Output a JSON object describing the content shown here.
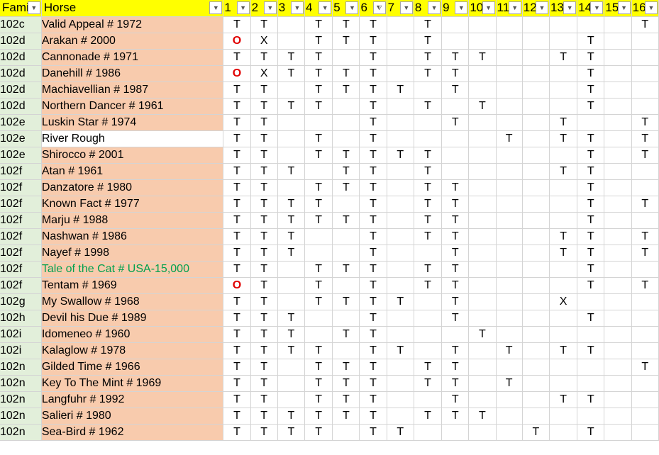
{
  "headers": {
    "family": "Fami",
    "horse": "Horse",
    "nums": [
      "1",
      "2",
      "3",
      "4",
      "5",
      "6",
      "7",
      "8",
      "9",
      "10",
      "11",
      "12",
      "13",
      "14",
      "15",
      "16"
    ],
    "filter_icon_col": "6"
  },
  "rows": [
    {
      "family": "102c",
      "horse": "Valid Appeal #  1972",
      "style": "",
      "cells": [
        "T",
        "T",
        "",
        "T",
        "T",
        "T",
        "",
        "T",
        "",
        "",
        "",
        "",
        "",
        "",
        "",
        "T"
      ]
    },
    {
      "family": "102d",
      "horse": "Arakan #  2000",
      "style": "",
      "cells": [
        "O",
        "X",
        "",
        "T",
        "T",
        "T",
        "",
        "T",
        "",
        "",
        "",
        "",
        "",
        "T",
        "",
        ""
      ]
    },
    {
      "family": "102d",
      "horse": "Cannonade #  1971",
      "style": "",
      "cells": [
        "T",
        "T",
        "T",
        "T",
        "",
        "T",
        "",
        "T",
        "T",
        "T",
        "",
        "",
        "T",
        "T",
        "",
        ""
      ]
    },
    {
      "family": "102d",
      "horse": "Danehill #  1986",
      "style": "",
      "cells": [
        "O",
        "X",
        "T",
        "T",
        "T",
        "T",
        "",
        "T",
        "T",
        "",
        "",
        "",
        "",
        "T",
        "",
        ""
      ]
    },
    {
      "family": "102d",
      "horse": "Machiavellian #  1987",
      "style": "",
      "cells": [
        "T",
        "T",
        "",
        "T",
        "T",
        "T",
        "T",
        "",
        "T",
        "",
        "",
        "",
        "",
        "T",
        "",
        ""
      ]
    },
    {
      "family": "102d",
      "horse": "Northern Dancer #  1961",
      "style": "",
      "cells": [
        "T",
        "T",
        "T",
        "T",
        "",
        "T",
        "",
        "T",
        "",
        "T",
        "",
        "",
        "",
        "T",
        "",
        ""
      ]
    },
    {
      "family": "102e",
      "horse": "Luskin Star #  1974",
      "style": "",
      "cells": [
        "T",
        "T",
        "",
        "",
        "",
        "T",
        "",
        "",
        "T",
        "",
        "",
        "",
        "T",
        "",
        "",
        "T"
      ]
    },
    {
      "family": "102e",
      "horse": "River Rough",
      "style": "white",
      "cells": [
        "T",
        "T",
        "",
        "T",
        "",
        "T",
        "",
        "",
        "",
        "",
        "T",
        "",
        "T",
        "T",
        "",
        "T"
      ]
    },
    {
      "family": "102e",
      "horse": "Shirocco #  2001",
      "style": "",
      "cells": [
        "T",
        "T",
        "",
        "T",
        "T",
        "T",
        "T",
        "T",
        "",
        "",
        "",
        "",
        "",
        "T",
        "",
        "T"
      ]
    },
    {
      "family": "102f",
      "horse": "Atan #  1961",
      "style": "",
      "cells": [
        "T",
        "T",
        "T",
        "",
        "T",
        "T",
        "",
        "T",
        "",
        "",
        "",
        "",
        "T",
        "T",
        "",
        ""
      ]
    },
    {
      "family": "102f",
      "horse": "Danzatore #  1980",
      "style": "",
      "cells": [
        "T",
        "T",
        "",
        "T",
        "T",
        "T",
        "",
        "T",
        "T",
        "",
        "",
        "",
        "",
        "T",
        "",
        ""
      ]
    },
    {
      "family": "102f",
      "horse": "Known Fact #  1977",
      "style": "",
      "cells": [
        "T",
        "T",
        "T",
        "T",
        "",
        "T",
        "",
        "T",
        "T",
        "",
        "",
        "",
        "",
        "T",
        "",
        "T"
      ]
    },
    {
      "family": "102f",
      "horse": "Marju #  1988",
      "style": "",
      "cells": [
        "T",
        "T",
        "T",
        "T",
        "T",
        "T",
        "",
        "T",
        "T",
        "",
        "",
        "",
        "",
        "T",
        "",
        ""
      ]
    },
    {
      "family": "102f",
      "horse": "Nashwan #  1986",
      "style": "",
      "cells": [
        "T",
        "T",
        "T",
        "",
        "",
        "T",
        "",
        "T",
        "T",
        "",
        "",
        "",
        "T",
        "T",
        "",
        "T"
      ]
    },
    {
      "family": "102f",
      "horse": "Nayef #  1998",
      "style": "",
      "cells": [
        "T",
        "T",
        "T",
        "",
        "",
        "T",
        "",
        "",
        "T",
        "",
        "",
        "",
        "T",
        "T",
        "",
        "T"
      ]
    },
    {
      "family": "102f",
      "horse": "Tale of the Cat #   USA-15,000",
      "style": "green",
      "cells": [
        "T",
        "T",
        "",
        "T",
        "T",
        "T",
        "",
        "T",
        "T",
        "",
        "",
        "",
        "",
        "T",
        "",
        ""
      ]
    },
    {
      "family": "102f",
      "horse": "Tentam #  1969",
      "style": "",
      "cells": [
        "O",
        "T",
        "",
        "T",
        "",
        "T",
        "",
        "T",
        "T",
        "",
        "",
        "",
        "",
        "T",
        "",
        "T"
      ]
    },
    {
      "family": "102g",
      "horse": "My Swallow #  1968",
      "style": "",
      "cells": [
        "T",
        "T",
        "",
        "T",
        "T",
        "T",
        "T",
        "",
        "T",
        "",
        "",
        "",
        "X",
        "",
        "",
        ""
      ]
    },
    {
      "family": "102h",
      "horse": "Devil his Due #  1989",
      "style": "",
      "cells": [
        "T",
        "T",
        "T",
        "",
        "",
        "T",
        "",
        "",
        "T",
        "",
        "",
        "",
        "",
        "T",
        "",
        ""
      ]
    },
    {
      "family": "102i",
      "horse": "Idomeneo #  1960",
      "style": "",
      "cells": [
        "T",
        "T",
        "T",
        "",
        "T",
        "T",
        "",
        "",
        "",
        "T",
        "",
        "",
        "",
        "",
        "",
        ""
      ]
    },
    {
      "family": "102i",
      "horse": "Kalaglow #  1978",
      "style": "",
      "cells": [
        "T",
        "T",
        "T",
        "T",
        "",
        "T",
        "T",
        "",
        "T",
        "",
        "T",
        "",
        "T",
        "T",
        "",
        ""
      ]
    },
    {
      "family": "102n",
      "horse": "Gilded Time #  1966",
      "style": "",
      "cells": [
        "T",
        "T",
        "",
        "T",
        "T",
        "T",
        "",
        "T",
        "T",
        "",
        "",
        "",
        "",
        "",
        "",
        "T"
      ]
    },
    {
      "family": "102n",
      "horse": "Key To The Mint #  1969",
      "style": "",
      "cells": [
        "T",
        "T",
        "",
        "T",
        "T",
        "T",
        "",
        "T",
        "T",
        "",
        "T",
        "",
        "",
        "",
        "",
        ""
      ]
    },
    {
      "family": "102n",
      "horse": "Langfuhr #  1992",
      "style": "",
      "cells": [
        "T",
        "T",
        "",
        "T",
        "T",
        "T",
        "",
        "",
        "T",
        "",
        "",
        "",
        "T",
        "T",
        "",
        ""
      ]
    },
    {
      "family": "102n",
      "horse": "Salieri #  1980",
      "style": "",
      "cells": [
        "T",
        "T",
        "T",
        "T",
        "T",
        "T",
        "",
        "T",
        "T",
        "T",
        "",
        "",
        "",
        "",
        "",
        ""
      ]
    },
    {
      "family": "102n",
      "horse": "Sea-Bird #  1962",
      "style": "",
      "cells": [
        "T",
        "T",
        "T",
        "T",
        "",
        "T",
        "T",
        "",
        "",
        "",
        "",
        "T",
        "",
        "T",
        "",
        ""
      ]
    }
  ],
  "colors": {
    "header": "#ffff00",
    "horse_bg": "#f8cbad",
    "family_bg": "#e2efda",
    "red_mark": "#e00000",
    "green_text": "#00a050"
  },
  "icons": {
    "dropdown": "chevron-down-icon",
    "filter": "filter-icon"
  }
}
